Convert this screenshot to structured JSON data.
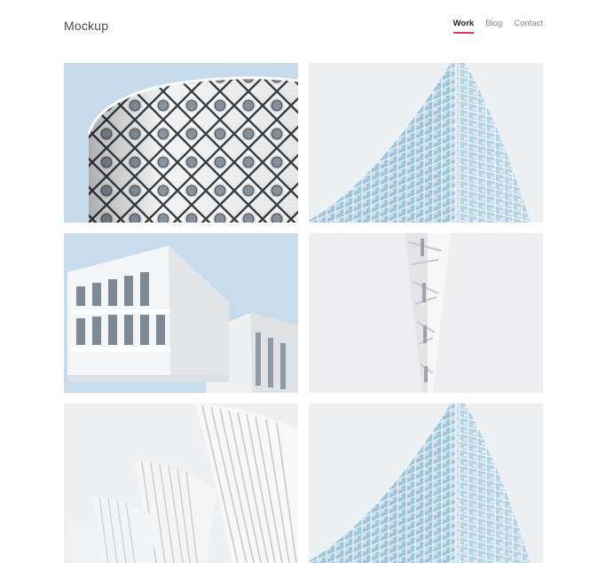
{
  "header": {
    "brand": "Mockup",
    "nav": [
      {
        "label": "Work",
        "active": true
      },
      {
        "label": "Blog",
        "active": false
      },
      {
        "label": "Contact",
        "active": false
      }
    ]
  },
  "colors": {
    "accent": "#e0336a",
    "sky": "#c9dcec",
    "background": "#ffffff"
  },
  "gallery": {
    "items": [
      {
        "subject": "round-tower-diamond-windows"
      },
      {
        "subject": "glass-facade-corner"
      },
      {
        "subject": "white-modular-building"
      },
      {
        "subject": "white-lattice-spire"
      },
      {
        "subject": "white-ribbed-fins"
      },
      {
        "subject": "glass-facade-corner"
      }
    ]
  }
}
